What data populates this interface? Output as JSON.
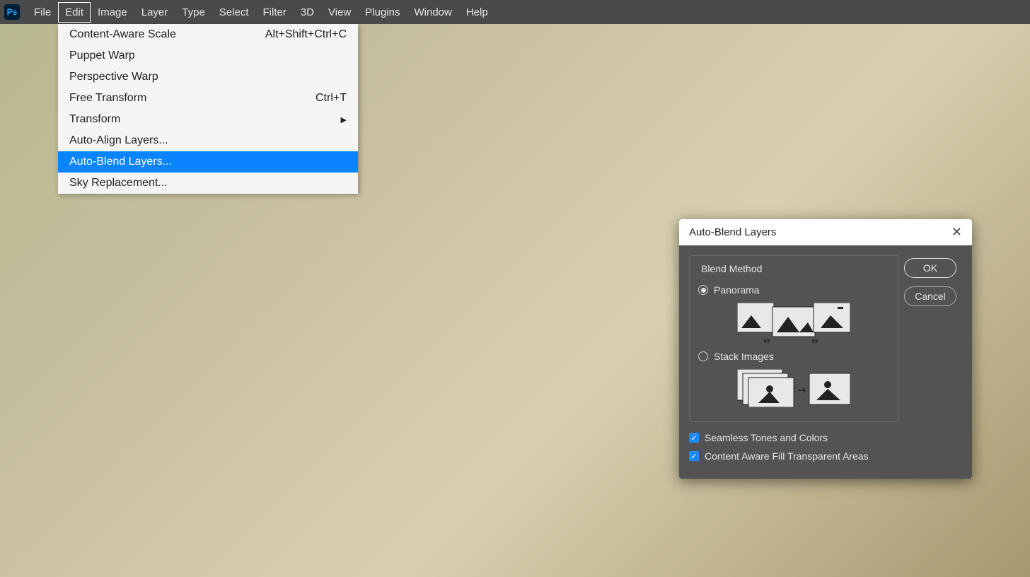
{
  "menubar": {
    "items": [
      "File",
      "Edit",
      "Image",
      "Layer",
      "Type",
      "Select",
      "Filter",
      "3D",
      "View",
      "Plugins",
      "Window",
      "Help"
    ],
    "active_index": 1
  },
  "dropdown": {
    "items": [
      {
        "label": "Content-Aware Scale",
        "shortcut": "Alt+Shift+Ctrl+C"
      },
      {
        "label": "Puppet Warp",
        "shortcut": ""
      },
      {
        "label": "Perspective Warp",
        "shortcut": ""
      },
      {
        "label": "Free Transform",
        "shortcut": "Ctrl+T"
      },
      {
        "label": "Transform",
        "shortcut": "",
        "submenu": true
      },
      {
        "label": "Auto-Align Layers...",
        "shortcut": ""
      },
      {
        "label": "Auto-Blend Layers...",
        "shortcut": "",
        "highlighted": true
      },
      {
        "label": "Sky Replacement...",
        "shortcut": ""
      }
    ]
  },
  "dialog": {
    "title": "Auto-Blend Layers",
    "blend_method_label": "Blend Method",
    "panorama_label": "Panorama",
    "stack_label": "Stack Images",
    "seamless_label": "Seamless Tones and Colors",
    "content_aware_label": "Content Aware Fill Transparent Areas",
    "ok_label": "OK",
    "cancel_label": "Cancel"
  }
}
